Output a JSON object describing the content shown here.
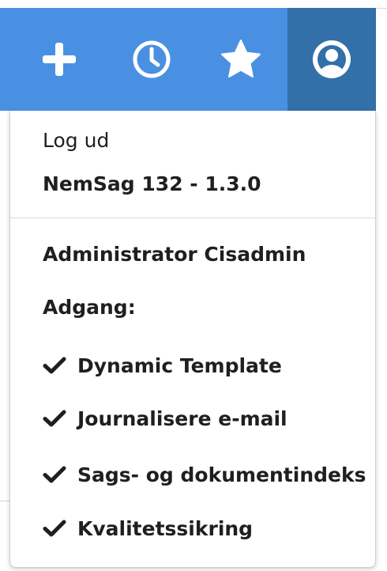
{
  "toolbar": {
    "icons": [
      "plus-icon",
      "clock-icon",
      "star-icon",
      "user-circle-icon"
    ],
    "colors": {
      "bar": "#4a90e2",
      "active": "#336fa8",
      "icon": "#ffffff"
    }
  },
  "menu": {
    "logout": "Log ud",
    "version": "NemSag 132 - 1.3.0",
    "user_name": "Administrator Cisadmin",
    "access_label": "Adgang:",
    "permissions": [
      "Dynamic Template",
      "Journalisere e-mail",
      "Sags- og dokumentindeks",
      "Kvalitetssikring"
    ]
  }
}
